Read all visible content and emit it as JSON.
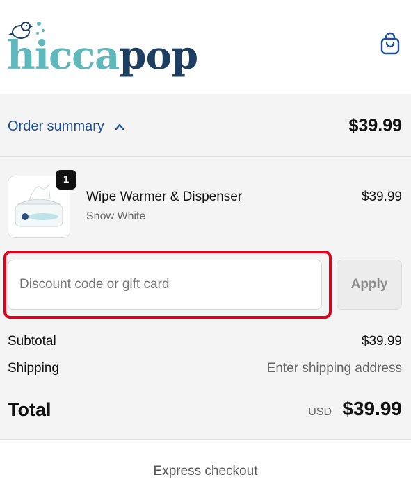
{
  "header": {
    "brand": {
      "part1": "hicca",
      "part2": "pop"
    },
    "cart_icon": "shopping-bag-icon"
  },
  "order_summary": {
    "toggle_label": "Order summary",
    "toggle_icon": "chevron-up-icon",
    "total": "$39.99"
  },
  "line_items": [
    {
      "name": "Wipe Warmer & Dispenser",
      "variant": "Snow White",
      "price": "$39.99",
      "quantity": "1"
    }
  ],
  "discount": {
    "placeholder": "Discount code or gift card",
    "value": "",
    "apply_label": "Apply"
  },
  "totals": {
    "subtotal_label": "Subtotal",
    "subtotal_value": "$39.99",
    "shipping_label": "Shipping",
    "shipping_value": "Enter shipping address",
    "total_label": "Total",
    "currency": "USD",
    "total_value": "$39.99"
  },
  "express_checkout": {
    "label": "Express checkout"
  },
  "colors": {
    "brand_teal": "#5fb8bb",
    "brand_navy": "#1f3f62",
    "link_blue": "#1f4fa0",
    "highlight_red": "#e0001b"
  }
}
